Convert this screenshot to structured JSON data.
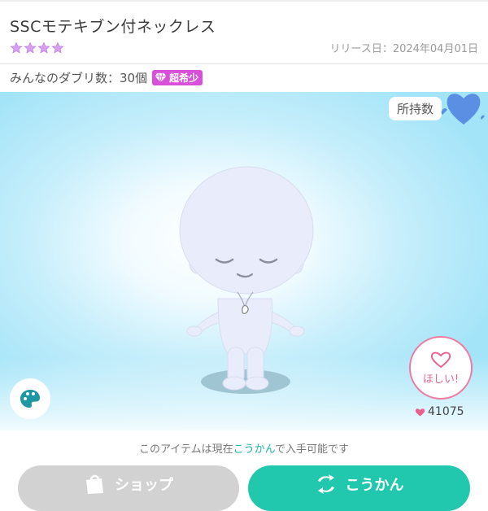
{
  "item": {
    "name": "SSCモテキブン付ネックレス",
    "stars": 4,
    "release_text": "リリース日：2024年04月01日",
    "duplicates_text": "みんなのダブリ数：30個",
    "rarity_label": "超希少"
  },
  "stage": {
    "owned_label": "所持数",
    "want_label": "ほしい!",
    "like_count": "41075"
  },
  "footer": {
    "availability_prefix": "このアイテムは現在",
    "availability_accent": "こうかん",
    "availability_suffix": "で入手可能です",
    "shop_label": "ショップ",
    "trade_label": "こうかん"
  },
  "colors": {
    "accent_teal": "#22c8ad",
    "rarity_magenta": "#d84fd8",
    "want_pink": "#f07aa0",
    "star_color": "#d9a0f0"
  },
  "icons": {
    "rarity": "diamond-icon",
    "owned": "heart-icon",
    "want": "heart-outline-icon",
    "like": "heart-icon",
    "palette": "palette-icon",
    "shop": "shopping-bag-icon",
    "trade": "exchange-icon"
  }
}
